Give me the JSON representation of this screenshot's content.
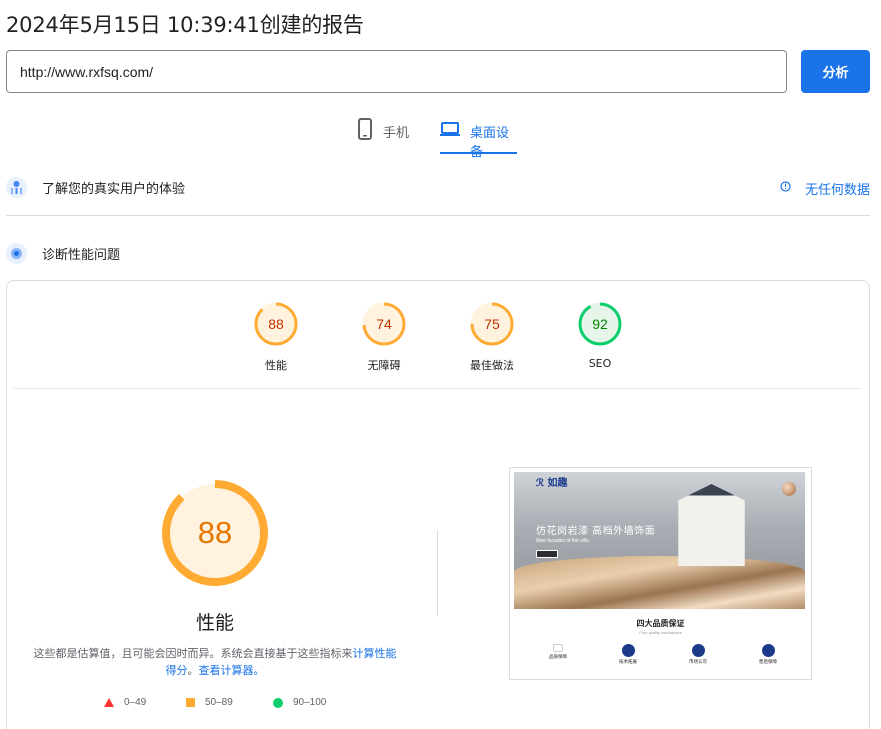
{
  "report": {
    "title": "2024年5月15日 10:39:41创建的报告"
  },
  "search": {
    "value": "http://www.rxfsq.com/",
    "button_label": "分析"
  },
  "tabs": [
    {
      "label": "手机",
      "icon": "phone-icon",
      "selected": false
    },
    {
      "label": "桌面设备",
      "icon": "laptop-icon",
      "selected": true
    }
  ],
  "real_users": {
    "label": "了解您的真实用户的体验",
    "no_data_label": "无任何数据",
    "icon": "real-user-icon"
  },
  "diagnose": {
    "label": "诊断性能问题",
    "icon": "lab-icon"
  },
  "scores": [
    {
      "label": "性能",
      "value": 88,
      "color": "#ffaa33",
      "text_color": "#c33300"
    },
    {
      "label": "无障碍",
      "value": 74,
      "color": "#ffaa33",
      "text_color": "#c33300"
    },
    {
      "label": "最佳做法",
      "value": 75,
      "color": "#ffaa33",
      "text_color": "#c33300"
    },
    {
      "label": "SEO",
      "value": 92,
      "color": "#0cce6b",
      "text_color": "#008800"
    }
  ],
  "main_score": {
    "value": 88,
    "label": "性能",
    "color": "#ffaa33"
  },
  "description": {
    "text": "这些都是估算值，且可能会因时而异。系统会直接基于这些指标来",
    "link1": "计算性能得分",
    "sep": "。",
    "link2": "查看计算器。"
  },
  "legend": [
    {
      "range": "0–49",
      "shape": "triangle",
      "color": "#ff3333"
    },
    {
      "range": "50–89",
      "shape": "square",
      "color": "#ffaa33"
    },
    {
      "range": "90–100",
      "shape": "circle",
      "color": "#0cce6b"
    }
  ],
  "screenshot": {
    "logo": "如趣",
    "hero_title": "仿花岗岩漆 高档外墙饰面",
    "hero_subtitle": "New facades of the villa",
    "section_title": "四大品质保证",
    "section_subtitle": "Four quality assurances",
    "features": [
      "品质保障",
      "技术拓展",
      "市场认可",
      "售后保障"
    ]
  }
}
